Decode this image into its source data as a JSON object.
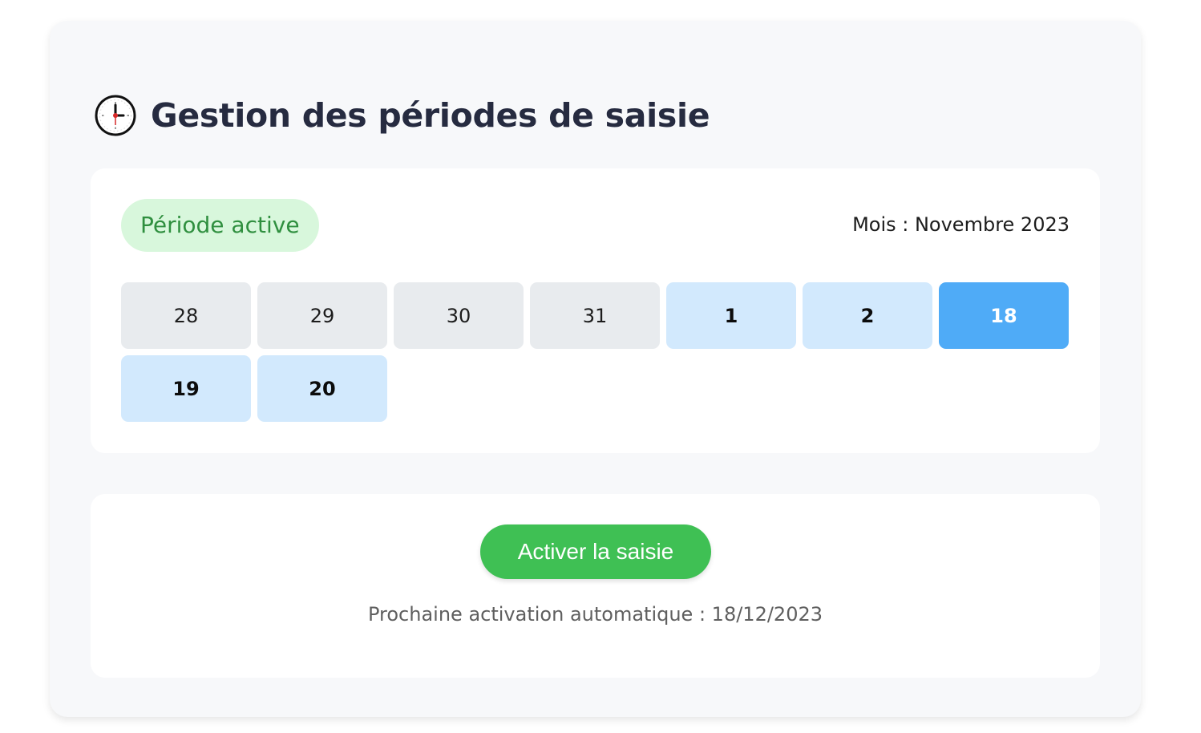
{
  "header": {
    "title": "Gestion des périodes de saisie",
    "icon": "clock-icon"
  },
  "period": {
    "status_label": "Période active",
    "month_label": "Mois : Novembre 2023",
    "days": [
      {
        "label": "28",
        "state": "past"
      },
      {
        "label": "29",
        "state": "past"
      },
      {
        "label": "30",
        "state": "past"
      },
      {
        "label": "31",
        "state": "past"
      },
      {
        "label": "1",
        "state": "open"
      },
      {
        "label": "2",
        "state": "open"
      },
      {
        "label": "18",
        "state": "today"
      },
      {
        "label": "19",
        "state": "open"
      },
      {
        "label": "20",
        "state": "open"
      }
    ]
  },
  "action": {
    "button_label": "Activer la saisie",
    "next_activation": "Prochaine activation automatique : 18/12/2023"
  },
  "colors": {
    "badge_bg": "#d8f7dc",
    "badge_text": "#2f8f3f",
    "day_past": "#e8ebee",
    "day_open": "#d2e9fd",
    "day_today": "#4fabf7",
    "button": "#3fc054",
    "title": "#262b40"
  }
}
